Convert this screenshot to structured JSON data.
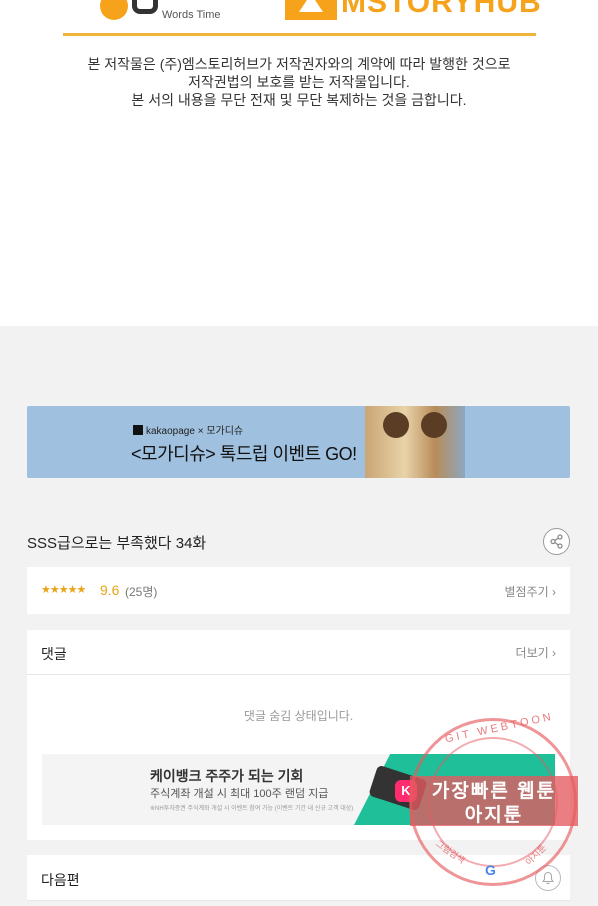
{
  "publisher": {
    "left_logo_text": "Words Time",
    "right_logo_text": "MSTORYHUB",
    "copyright_lines": [
      "본 저작물은 (주)엠스토리허브가 저작권자와의 계약에 따라 발행한 것으로",
      "저작권법의 보호를 받는 저작물입니다.",
      "본 서의 내용을 무단 전재 및 무단 복제하는 것을 금합니다."
    ]
  },
  "banner": {
    "brand": "kakaopage × 모가디슈",
    "title": "<모가디슈> 톡드립 이벤트 GO!"
  },
  "episode": {
    "title": "SSS급으로는 부족했다 34화"
  },
  "rating": {
    "stars": "★★★★★",
    "score": "9.6",
    "count": "(25명)",
    "rate_link": "별점주기 ›"
  },
  "comments": {
    "title": "댓글",
    "more": "더보기 ›",
    "hidden_notice": "댓글 숨김 상태입니다."
  },
  "ad": {
    "title": "케이뱅크 주주가 되는 기회",
    "subtitle": "주식계좌 개설 시 최대 100주 랜덤 지급",
    "fine_print": "※NH투자증권 주식계좌 개설 시 이벤트 참여 가능 (이벤트 기간 내 신규 고객 대상)",
    "partner": "NH투자증권",
    "app_letter": "K"
  },
  "next": {
    "label": "다음편"
  },
  "watermark": {
    "arc_text": "GIT WEBTOON",
    "line1": "가장빠른 웹툰",
    "line2": "아지툰",
    "bottom_left": "그림검색",
    "bottom_right": "아지툰",
    "google": "G"
  }
}
